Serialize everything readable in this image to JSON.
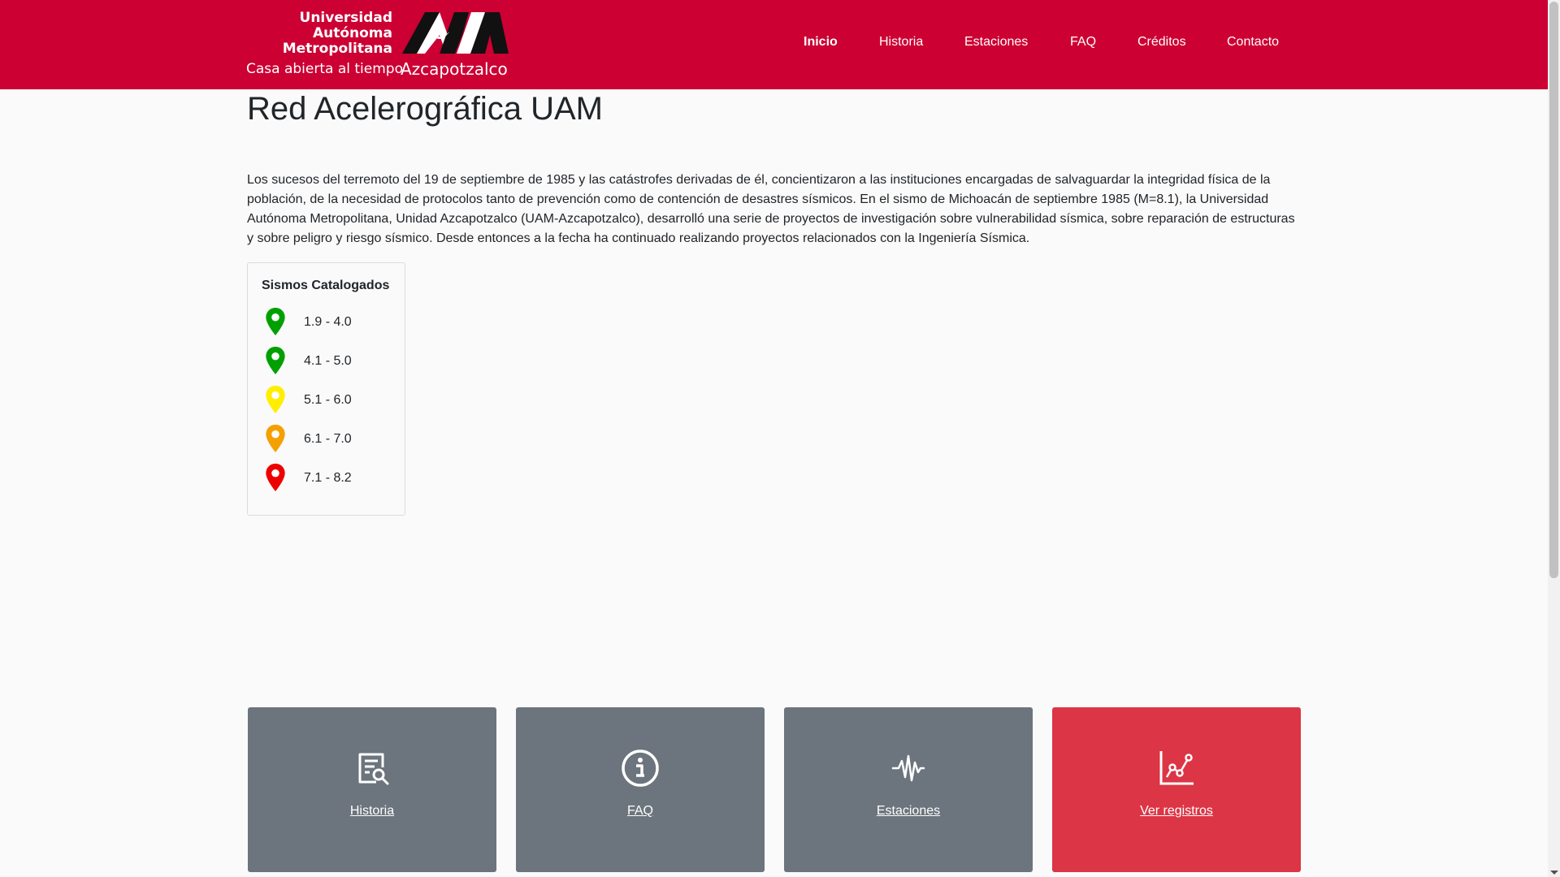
{
  "brand": {
    "line1": "Universidad",
    "line2": "Autónoma",
    "line3": "Metropolitana",
    "tagline": "Casa abierta al tiempo",
    "unit": "Azcapotzalco"
  },
  "nav": {
    "items": [
      {
        "label": "Inicio",
        "active": true
      },
      {
        "label": "Historia"
      },
      {
        "label": "Estaciones"
      },
      {
        "label": "FAQ"
      },
      {
        "label": "Créditos"
      },
      {
        "label": "Contacto"
      }
    ]
  },
  "main": {
    "title": "Red Acelerográfica UAM",
    "intro": "Los sucesos del terremoto del 19 de septiembre de 1985 y las catástrofes derivadas de él, concientizaron a las instituciones encargadas de salvaguardar la integridad física de la población, de la necesidad de protocolos tanto de prevención como de contención de desastres sísmicos. En el sismo de Michoacán de septiembre 1985 (M=8.1), la Universidad Autónoma Metropolitana, Unidad Azcapotzalco (UAM-Azcapotzalco), desarrolló una serie de proyectos de investigación sobre vulnerabilidad sísmica, sobre reparación de estructuras y sobre peligro y riesgo sísmico. Desde entonces a la fecha ha continuado realizando proyectos relacionados con la Ingeniería Sísmica."
  },
  "legend": {
    "title": "Sismos Catalogados",
    "items": [
      {
        "label": "1.9 - 4.0",
        "color": "#00a000",
        "icon": "map-pin-icon"
      },
      {
        "label": "4.1 - 5.0",
        "color": "#00a000",
        "icon": "map-pin-icon"
      },
      {
        "label": "5.1 - 6.0",
        "color": "#ffee00",
        "icon": "map-pin-icon"
      },
      {
        "label": "6.1 - 7.0",
        "color": "#f5a000",
        "icon": "map-pin-icon"
      },
      {
        "label": "7.1 - 8.2",
        "color": "#ee0000",
        "icon": "map-pin-icon"
      }
    ]
  },
  "cards": [
    {
      "label": "Historia",
      "icon": "document-search-icon",
      "color": "#6c757d"
    },
    {
      "label": "FAQ",
      "icon": "info-circle-icon",
      "color": "#6c757d"
    },
    {
      "label": "Estaciones",
      "icon": "seismograph-icon",
      "color": "#6c757d"
    },
    {
      "label": "Ver registros",
      "icon": "line-chart-icon",
      "color": "#dc3545"
    }
  ],
  "colors": {
    "navbar": "#cc0033",
    "card_gray": "#6c757d",
    "card_red": "#dc3545"
  }
}
